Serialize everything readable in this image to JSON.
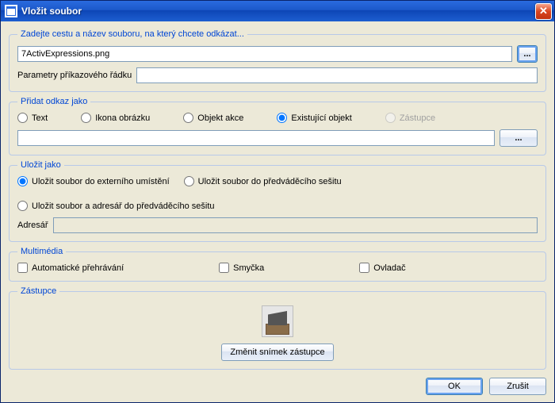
{
  "window": {
    "title": "Vložit soubor"
  },
  "path_section": {
    "legend": "Zadejte cestu a název souboru, na který chcete odkázat...",
    "file_value": "7ActivExpressions.png",
    "browse_label": "...",
    "params_label": "Parametry příkazového řádku",
    "params_value": ""
  },
  "link_section": {
    "legend": "Přidat odkaz jako",
    "options": {
      "text": "Text",
      "icon": "Ikona obrázku",
      "action": "Objekt akce",
      "existing": "Existující objekt",
      "placeholder": "Zástupce"
    },
    "selected": "existing",
    "input_value": "",
    "browse_label": "..."
  },
  "save_section": {
    "legend": "Uložit jako",
    "options": {
      "external": "Uložit soubor do externího umístění",
      "flipchart": "Uložit soubor do předváděcího sešitu",
      "both": "Uložit soubor a adresář do předváděcího sešitu"
    },
    "selected": "external",
    "dir_label": "Adresář",
    "dir_value": ""
  },
  "media_section": {
    "legend": "Multimédia",
    "autoplay": "Automatické přehrávání",
    "loop": "Smyčka",
    "controller": "Ovladač"
  },
  "placeholder_section": {
    "legend": "Zástupce",
    "change_label": "Změnit snímek zástupce"
  },
  "footer": {
    "ok": "OK",
    "cancel": "Zrušit"
  }
}
